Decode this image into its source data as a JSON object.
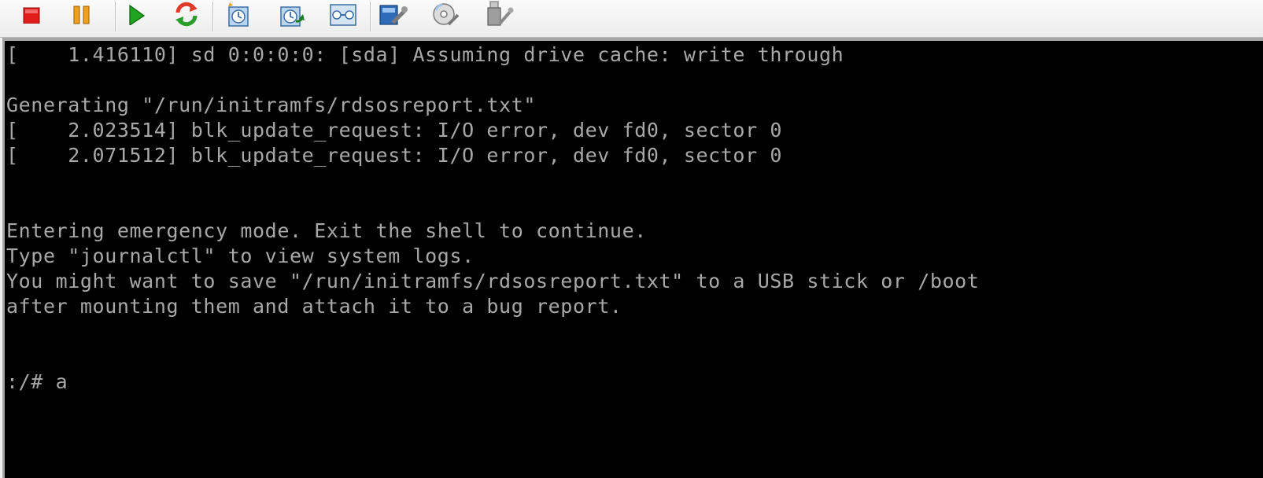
{
  "toolbar": {
    "buttons": [
      {
        "name": "power-off-button",
        "icon": "stop-icon",
        "color": "#e01b1b"
      },
      {
        "name": "pause-button",
        "icon": "pause-icon",
        "color": "#f0a020"
      },
      {
        "name": "power-on-button",
        "icon": "play-icon",
        "color": "#1fa51f"
      },
      {
        "name": "reset-button",
        "icon": "refresh-icon",
        "color": "#e03a2a"
      },
      {
        "name": "take-snapshot-button",
        "icon": "snapshot-icon"
      },
      {
        "name": "revert-snapshot-button",
        "icon": "revert-snapshot-icon"
      },
      {
        "name": "snapshot-manager-button",
        "icon": "snapshot-manager-icon"
      },
      {
        "name": "vm-settings-button",
        "icon": "settings-icon"
      },
      {
        "name": "removable-devices-button",
        "icon": "cd-icon"
      },
      {
        "name": "usb-devices-button",
        "icon": "usb-icon"
      }
    ]
  },
  "console": {
    "lines": [
      "[    1.416110] sd 0:0:0:0: [sda] Assuming drive cache: write through",
      "",
      "Generating \"/run/initramfs/rdsosreport.txt\"",
      "[    2.023514] blk_update_request: I/O error, dev fd0, sector 0",
      "[    2.071512] blk_update_request: I/O error, dev fd0, sector 0",
      "",
      "",
      "Entering emergency mode. Exit the shell to continue.",
      "Type \"journalctl\" to view system logs.",
      "You might want to save \"/run/initramfs/rdsosreport.txt\" to a USB stick or /boot",
      "after mounting them and attach it to a bug report.",
      "",
      "",
      ":/# a"
    ]
  }
}
